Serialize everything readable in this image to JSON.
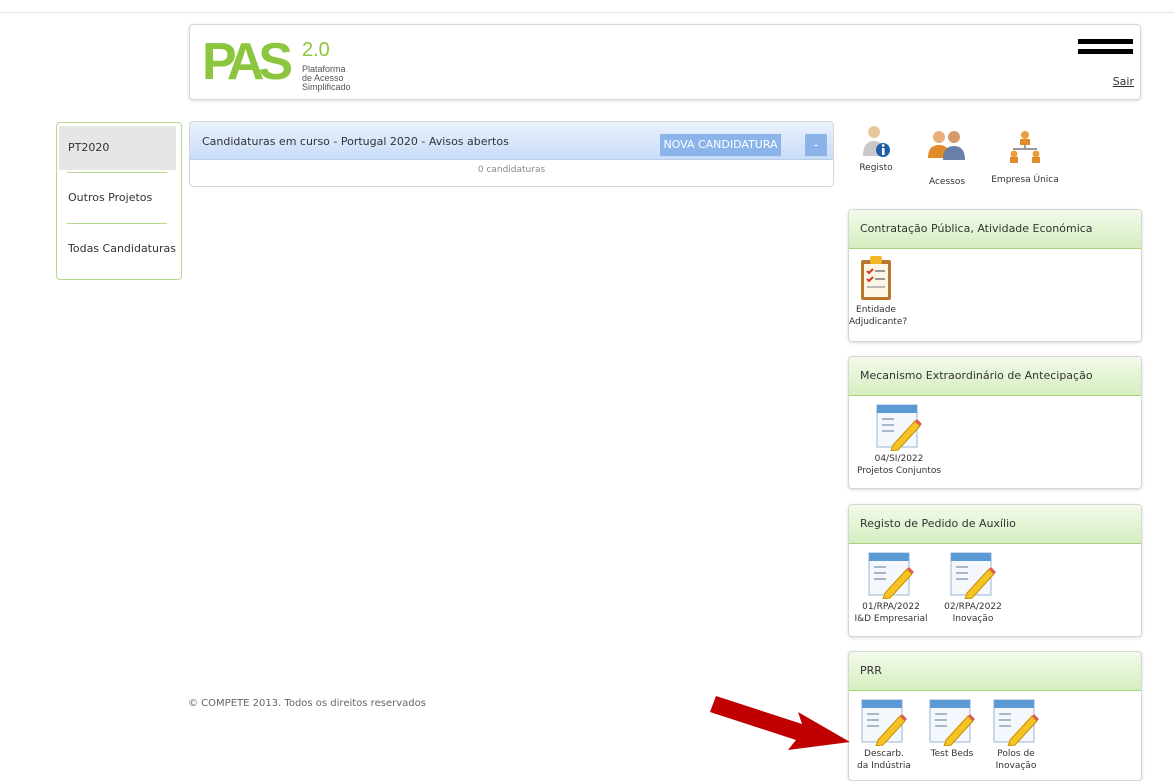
{
  "header": {
    "logo_text": "PAS",
    "logo_version": "2.0",
    "logo_subtitle": [
      "Plataforma",
      "de Acesso",
      "Simplificado"
    ],
    "logout_label": "Sair"
  },
  "sidebar": {
    "items": [
      {
        "label": "PT2020",
        "active": true
      },
      {
        "label": "Outros Projetos",
        "active": false
      },
      {
        "label": "Todas Candidaturas",
        "active": false
      }
    ]
  },
  "main": {
    "panel_title": "Candidaturas em curso - Portugal 2020 - Avisos abertos",
    "new_button": "NOVA CANDIDATURA",
    "collapse_button": "-",
    "count_text": "0 candidaturas"
  },
  "footer": {
    "copyright": "© COMPETE 2013. Todos os direitos reservados"
  },
  "tools": [
    {
      "label": "Registo",
      "icon": "user-info-icon"
    },
    {
      "label": "Acessos",
      "icon": "users-icon"
    },
    {
      "label": "Empresa Única",
      "icon": "org-chart-icon"
    }
  ],
  "boxes": [
    {
      "title": "Contratação Pública, Atividade Económica",
      "items": [
        {
          "lines": [
            "Entidade",
            "Adjudicante?"
          ],
          "icon": "clipboard-checklist-icon"
        }
      ]
    },
    {
      "title": "Mecanismo Extraordinário de Antecipação",
      "items": [
        {
          "lines": [
            "04/SI/2022",
            "Projetos Conjuntos"
          ],
          "icon": "edit-form-icon"
        }
      ]
    },
    {
      "title": "Registo de Pedido de Auxílio",
      "items": [
        {
          "lines": [
            "01/RPA/2022",
            "I&D Empresarial"
          ],
          "icon": "edit-form-icon"
        },
        {
          "lines": [
            "02/RPA/2022",
            "Inovação"
          ],
          "icon": "edit-form-icon"
        }
      ]
    },
    {
      "title": "PRR",
      "items": [
        {
          "lines": [
            "Descarb.",
            "da Indústria"
          ],
          "icon": "edit-form-icon"
        },
        {
          "lines": [
            "Test Beds",
            ""
          ],
          "icon": "edit-form-icon"
        },
        {
          "lines": [
            "Polos de",
            "Inovação"
          ],
          "icon": "edit-form-icon"
        }
      ]
    }
  ],
  "colors": {
    "logo_green": "#8cc63f",
    "panel_blue": "#8ab4ea",
    "box_green": "#d5eec0",
    "arrow_red": "#c00000"
  }
}
